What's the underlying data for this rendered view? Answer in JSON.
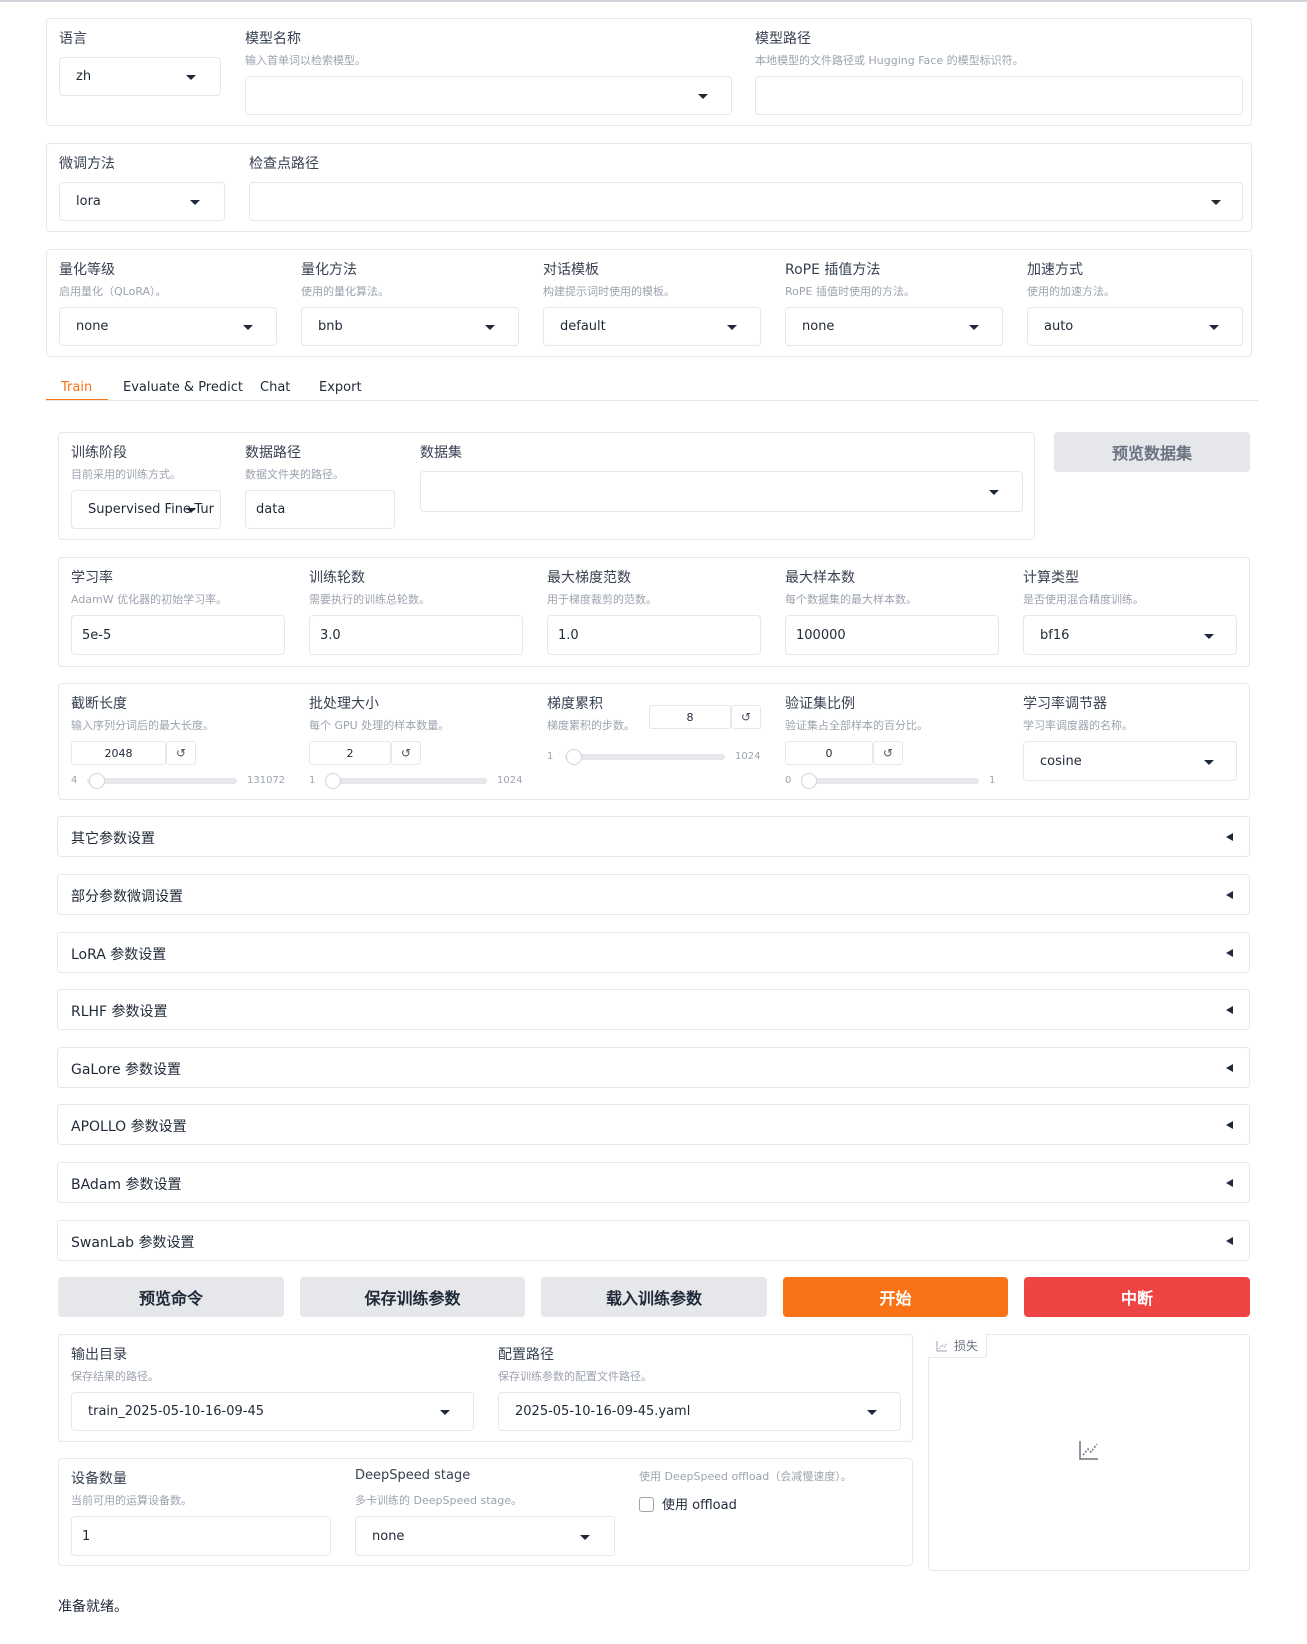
{
  "top": {
    "lang": {
      "label": "语言",
      "value": "zh"
    },
    "model_name": {
      "label": "模型名称",
      "info": "输入首单词以检索模型。",
      "value": ""
    },
    "model_path": {
      "label": "模型路径",
      "info": "本地模型的文件路径或 Hugging Face 的模型标识符。",
      "value": ""
    }
  },
  "method": {
    "finetune": {
      "label": "微调方法",
      "value": "lora"
    },
    "checkpoint": {
      "label": "检查点路径",
      "value": ""
    }
  },
  "quant": {
    "quant_bit": {
      "label": "量化等级",
      "info": "启用量化（QLoRA）。",
      "value": "none"
    },
    "quant_method": {
      "label": "量化方法",
      "info": "使用的量化算法。",
      "value": "bnb"
    },
    "template": {
      "label": "对话模板",
      "info": "构建提示词时使用的模板。",
      "value": "default"
    },
    "rope": {
      "label": "RoPE 插值方法",
      "info": "RoPE 插值时使用的方法。",
      "value": "none"
    },
    "booster": {
      "label": "加速方式",
      "info": "使用的加速方法。",
      "value": "auto"
    }
  },
  "tabs": [
    "Train",
    "Evaluate & Predict",
    "Chat",
    "Export"
  ],
  "train": {
    "stage": {
      "label": "训练阶段",
      "info": "目前采用的训练方式。",
      "value": "Supervised Fine-Tur"
    },
    "dataset_dir": {
      "label": "数据路径",
      "info": "数据文件夹的路径。",
      "value": "data"
    },
    "dataset": {
      "label": "数据集",
      "value": ""
    },
    "preview_dataset": "预览数据集",
    "lr": {
      "label": "学习率",
      "info": "AdamW 优化器的初始学习率。",
      "value": "5e-5"
    },
    "epochs": {
      "label": "训练轮数",
      "info": "需要执行的训练总轮数。",
      "value": "3.0"
    },
    "max_grad_norm": {
      "label": "最大梯度范数",
      "info": "用于梯度裁剪的范数。",
      "value": "1.0"
    },
    "max_samples": {
      "label": "最大样本数",
      "info": "每个数据集的最大样本数。",
      "value": "100000"
    },
    "compute_type": {
      "label": "计算类型",
      "info": "是否使用混合精度训练。",
      "value": "bf16"
    },
    "cutoff_len": {
      "label": "截断长度",
      "info": "输入序列分词后的最大长度。",
      "value": "2048",
      "min": "4",
      "max": "131072",
      "level": 0.015
    },
    "batch_size": {
      "label": "批处理大小",
      "info": "每个 GPU 处理的样本数量。",
      "value": "2",
      "min": "1",
      "max": "1024",
      "level": 0.001
    },
    "grad_accum": {
      "label": "梯度累积",
      "info": "梯度累积的步数。",
      "value": "8",
      "min": "1",
      "max": "1024",
      "level": 0.007
    },
    "val_size": {
      "label": "验证集比例",
      "info": "验证集占全部样本的百分比。",
      "value": "0",
      "min": "0",
      "max": "1",
      "level": 0.0
    },
    "lr_scheduler": {
      "label": "学习率调节器",
      "info": "学习率调度器的名称。",
      "value": "cosine"
    },
    "reset_glyph": "↺"
  },
  "accordions": [
    "其它参数设置",
    "部分参数微调设置",
    "LoRA 参数设置",
    "RLHF 参数设置",
    "GaLore 参数设置",
    "APOLLO 参数设置",
    "BAdam 参数设置",
    "SwanLab 参数设置"
  ],
  "actions": {
    "preview": "预览命令",
    "save": "保存训练参数",
    "load": "载入训练参数",
    "start": "开始",
    "stop": "中断"
  },
  "output": {
    "output_dir": {
      "label": "输出目录",
      "info": "保存结果的路径。",
      "value": "train_2025-05-10-16-09-45"
    },
    "config_path": {
      "label": "配置路径",
      "info": "保存训练参数的配置文件路径。",
      "value": "2025-05-10-16-09-45.yaml"
    },
    "device_count": {
      "label": "设备数量",
      "info": "当前可用的运算设备数。",
      "value": "1"
    },
    "ds_stage": {
      "label": "DeepSpeed stage",
      "info": "多卡训练的 DeepSpeed stage。",
      "value": "none"
    },
    "ds_offload": {
      "info": "使用 DeepSpeed offload（会减慢速度）。",
      "label": "使用 offload",
      "checked": false
    }
  },
  "plot": {
    "label": "损失",
    "icon": "chart-icon"
  },
  "status": "准备就绪。",
  "colors": {
    "accent": "#f97316",
    "danger": "#ef4444",
    "border": "#e5e7eb",
    "muted": "#9ca3af"
  }
}
